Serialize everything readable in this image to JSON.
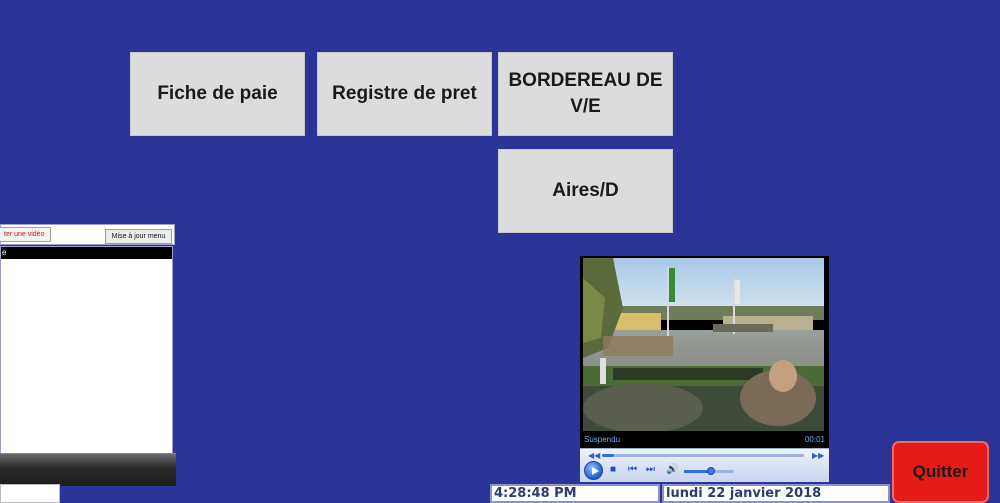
{
  "menu": {
    "fiche_label": "Fiche de paie",
    "registre_label": "Registre de pret",
    "bordereau_label": "BORDEREAU DE V/E",
    "aires_label": "Aires/D"
  },
  "video_panel": {
    "add_label": "ter une vidéo",
    "refresh_label": "Mise à jour menu"
  },
  "player": {
    "status": "Suspendu",
    "elapsed": "00:01",
    "progress_fraction": 0.06,
    "volume_fraction": 0.5
  },
  "footer": {
    "time": "4:28:48 PM",
    "date": "lundi 22 janvier 2018",
    "quit_label": "Quitter"
  },
  "colors": {
    "background": "#2c3597",
    "menu_button": "#dcdcdc",
    "quit_button": "#e41b17"
  }
}
